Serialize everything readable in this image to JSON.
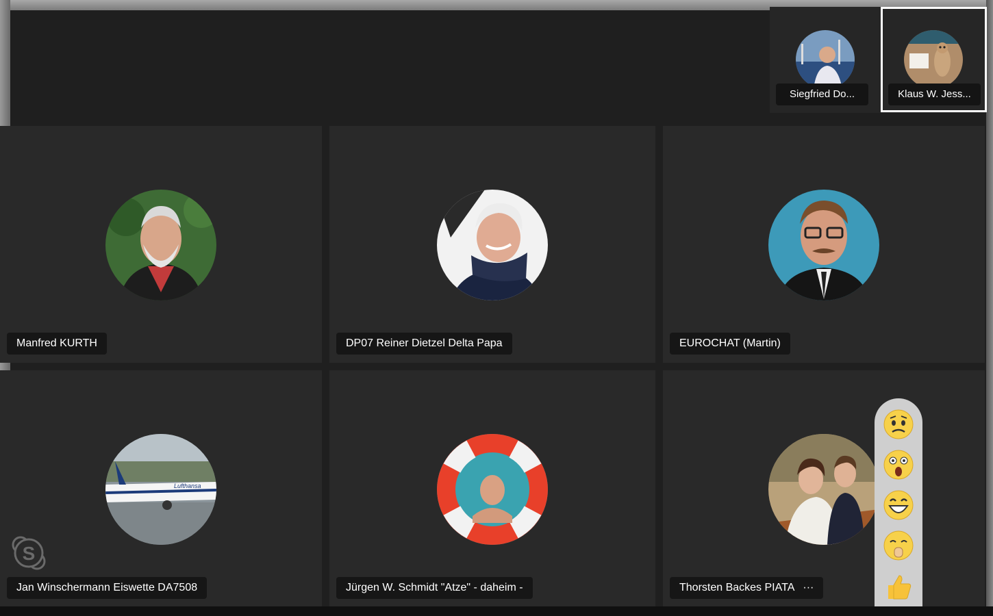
{
  "thumbnails": [
    {
      "name": "Siegfried Do...",
      "active": false
    },
    {
      "name": "Klaus W. Jess...",
      "active": true
    }
  ],
  "tiles": [
    {
      "name": "Manfred KURTH"
    },
    {
      "name": "DP07 Reiner Dietzel Delta Papa"
    },
    {
      "name": "EUROCHAT (Martin)"
    },
    {
      "name": "Jan Winschermann Eiswette DA7508"
    },
    {
      "name": "Jürgen W. Schmidt \"Atze\" - daheim -"
    },
    {
      "name": "Thorsten Backes PIATA",
      "more": "···"
    }
  ],
  "reactions": [
    "worried-emoji",
    "surprised-emoji",
    "laughing-emoji",
    "blush-emoji",
    "thumbs-up-emoji"
  ],
  "colors": {
    "stage": "#1f1f1f",
    "tile": "#292929",
    "pill": "#161616",
    "reaction_bar": "#cfcfcf",
    "emoji": "#f7d14a"
  }
}
